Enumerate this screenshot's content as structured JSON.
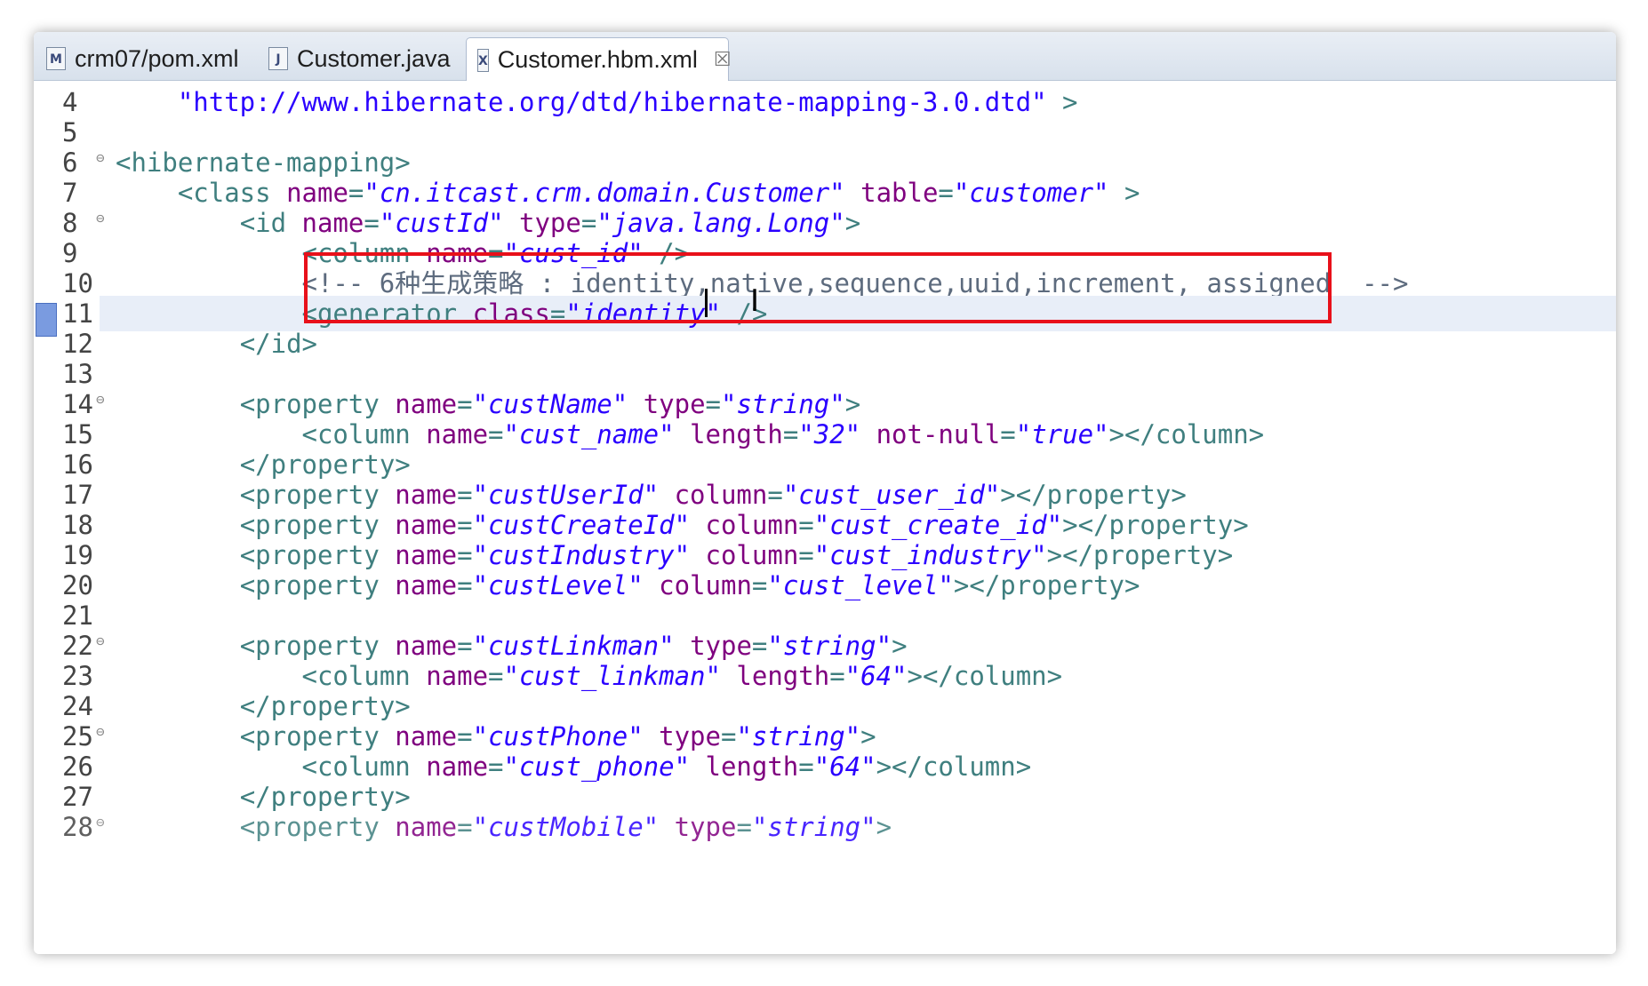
{
  "tabs": [
    {
      "label": "crm07/pom.xml",
      "icon": "xml-file-icon",
      "icon_glyph": "M"
    },
    {
      "label": "Customer.java",
      "icon": "java-file-icon",
      "icon_glyph": "J"
    },
    {
      "label": "Customer.hbm.xml",
      "icon": "xml-file-icon",
      "icon_glyph": "X",
      "active": true,
      "close": "☒"
    }
  ],
  "colors": {
    "tag": "#3f7f7f",
    "attribute": "#7f007f",
    "value": "#2a00ff",
    "highlight_box": "#e8101a",
    "current_line": "#e8eef8"
  },
  "current_line": "11",
  "lines": [
    {
      "n": "4",
      "text": "    \"http://www.hibernate.org/dtd/hibernate-mapping-3.0.dtd\" >"
    },
    {
      "n": "5",
      "text": ""
    },
    {
      "n": "6",
      "text": "<hibernate-mapping>",
      "fold": true
    },
    {
      "n": "7",
      "text": "    <class name=\"cn.itcast.crm.domain.Customer\" table=\"customer\" >"
    },
    {
      "n": "8",
      "text": "        <id name=\"custId\" type=\"java.lang.Long\">",
      "fold": true
    },
    {
      "n": "9",
      "text": "            <column name=\"cust_id\" />"
    },
    {
      "n": "10",
      "text": "            <!-- 6种生成策略 : identity,native,sequence,uuid,increment, assigned  -->"
    },
    {
      "n": "11",
      "text": "            <generator class=\"identity\" />"
    },
    {
      "n": "12",
      "text": "        </id>"
    },
    {
      "n": "13",
      "text": ""
    },
    {
      "n": "14",
      "text": "        <property name=\"custName\" type=\"string\">",
      "fold": true
    },
    {
      "n": "15",
      "text": "            <column name=\"cust_name\" length=\"32\" not-null=\"true\"></column>"
    },
    {
      "n": "16",
      "text": "        </property>"
    },
    {
      "n": "17",
      "text": "        <property name=\"custUserId\" column=\"cust_user_id\"></property>"
    },
    {
      "n": "18",
      "text": "        <property name=\"custCreateId\" column=\"cust_create_id\"></property>"
    },
    {
      "n": "19",
      "text": "        <property name=\"custIndustry\" column=\"cust_industry\"></property>"
    },
    {
      "n": "20",
      "text": "        <property name=\"custLevel\" column=\"cust_level\"></property>"
    },
    {
      "n": "21",
      "text": ""
    },
    {
      "n": "22",
      "text": "        <property name=\"custLinkman\" type=\"string\">",
      "fold": true
    },
    {
      "n": "23",
      "text": "            <column name=\"cust_linkman\" length=\"64\"></column>"
    },
    {
      "n": "24",
      "text": "        </property>"
    },
    {
      "n": "25",
      "text": "        <property name=\"custPhone\" type=\"string\">",
      "fold": true
    },
    {
      "n": "26",
      "text": "            <column name=\"cust_phone\" length=\"64\"></column>"
    },
    {
      "n": "27",
      "text": "        </property>"
    },
    {
      "n": "28",
      "text": "        <property name=\"custMobile\" type=\"string\">",
      "fold": true
    }
  ]
}
